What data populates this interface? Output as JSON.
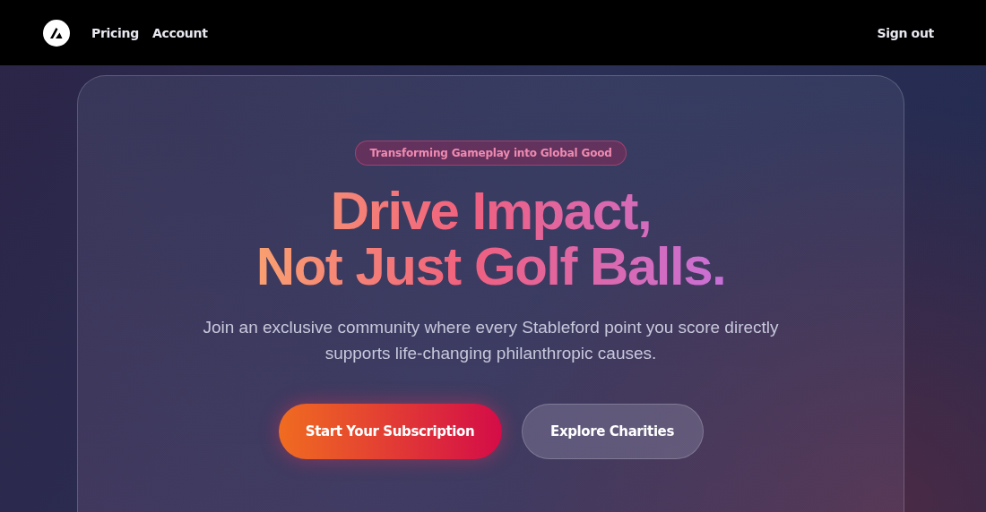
{
  "header": {
    "nav": [
      {
        "label": "Pricing"
      },
      {
        "label": "Account"
      }
    ],
    "sign_out": "Sign out"
  },
  "hero": {
    "badge": "Transforming Gameplay into Global Good",
    "headline": [
      "Drive Impact,",
      "Not Just Golf Balls."
    ],
    "subtitle": "Join an exclusive community where every Stableford point you score directly supports life-changing philanthropic causes.",
    "buttons": [
      {
        "label": "Start Your Subscription",
        "kind": "primary"
      },
      {
        "label": "Explore Charities",
        "kind": "secondary"
      }
    ]
  }
}
